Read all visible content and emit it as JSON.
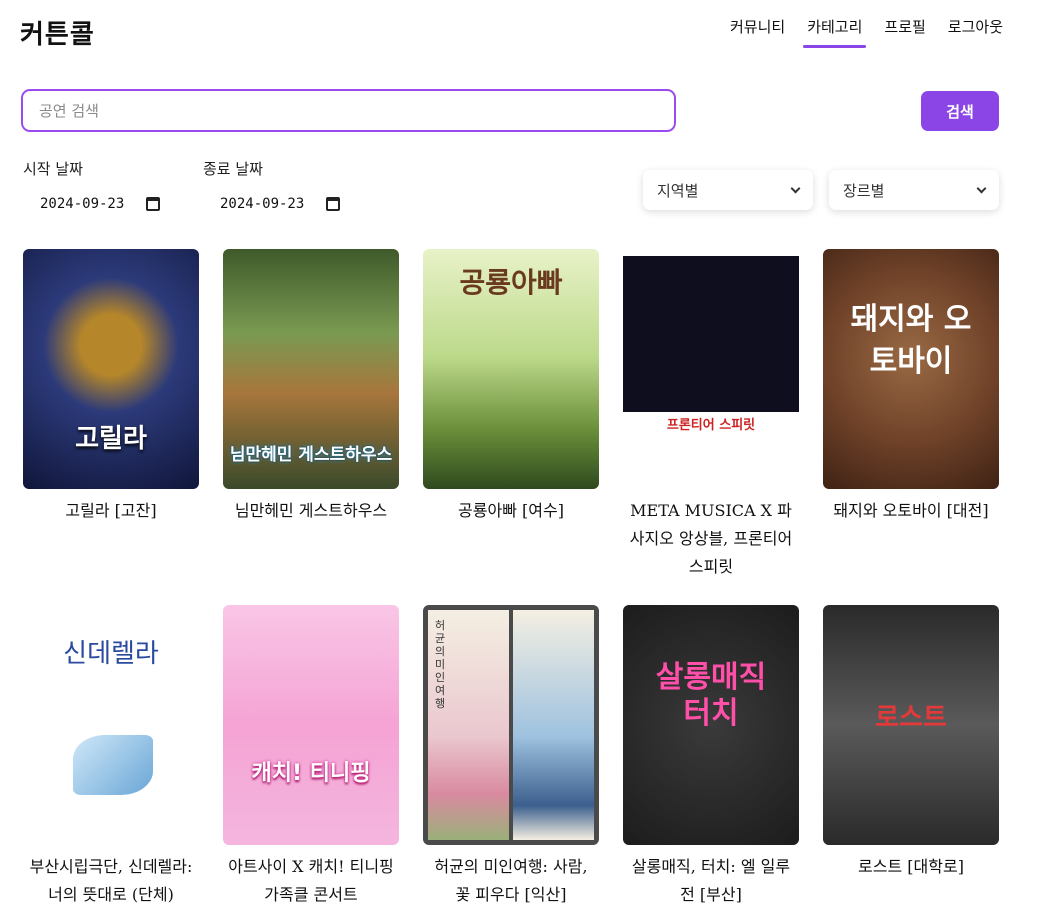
{
  "header": {
    "logo": "커튼콜",
    "nav": [
      "커뮤니티",
      "카테고리",
      "프로필",
      "로그아웃"
    ],
    "active_nav": "카테고리"
  },
  "search": {
    "placeholder": "공연 검색",
    "value": "",
    "button_label": "검색"
  },
  "filters": {
    "start_date_label": "시작 날짜",
    "start_date": "2024-09-23",
    "end_date_label": "종료 날짜",
    "end_date": "2024-09-23",
    "region_select": "지역별",
    "genre_select": "장르별"
  },
  "posters": [
    {
      "title": "고릴라 [고잔]",
      "poster_text": "고릴라",
      "bg": "#2c3a7a"
    },
    {
      "title": "님만헤민 게스트하우스",
      "poster_text": "님만헤민 게스트하우스",
      "bg": "#5f7d3a"
    },
    {
      "title": "공룡아빠 [여수]",
      "poster_text": "공룡아빠",
      "bg": "#cfe3a8"
    },
    {
      "title": "META MUSICA X 파사지오 앙상블, 프론티어 스피릿",
      "poster_text": "프론티어 스피릿",
      "bg": "#1a1a2e"
    },
    {
      "title": "돼지와 오토바이 [대전]",
      "poster_text": "돼지와 오토바이",
      "bg": "#7a4a2e"
    },
    {
      "title": "부산시립극단, 신데렐라: 너의 뜻대로 (단체)",
      "poster_text": "신데렐라",
      "bg": "#ffffff"
    },
    {
      "title": "아트사이 X 캐치! 티니핑 가족클 콘서트",
      "poster_text": "캐치! 티니핑",
      "bg": "#f7a8d8"
    },
    {
      "title": "허균의 미인여행: 사람, 꽃 피우다 [익산]",
      "poster_text": "허균의 미인여행",
      "bg": "#e8e2d2"
    },
    {
      "title": "살롱매직, 터치: 엘 일루전 [부산]",
      "poster_text": "살롱매직 터치",
      "bg": "#2b2b2b"
    },
    {
      "title": "로스트 [대학로]",
      "poster_text": "로스트",
      "bg": "#3a3a3a"
    }
  ]
}
